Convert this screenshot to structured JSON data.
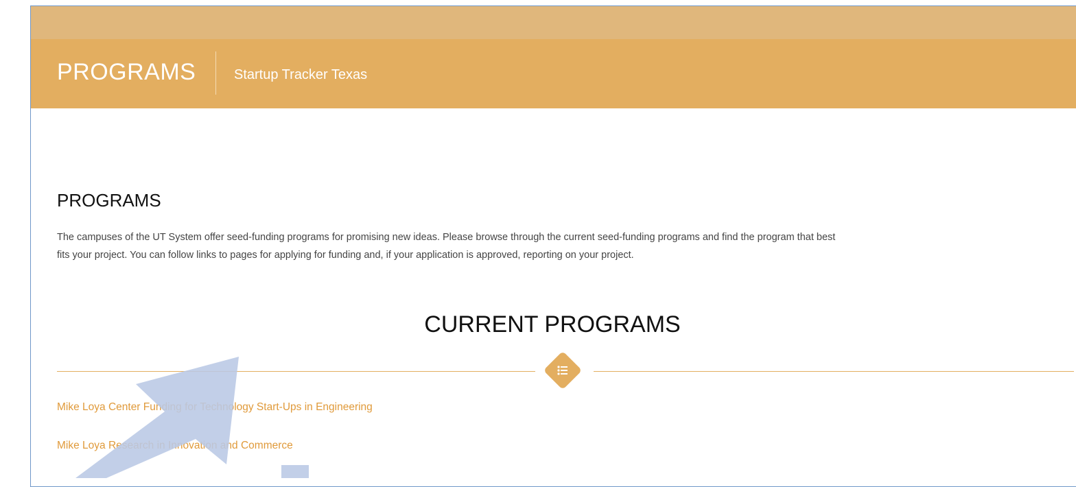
{
  "header": {
    "brand": "PROGRAMS",
    "site_name": "Startup Tracker Texas"
  },
  "main": {
    "heading": "PROGRAMS",
    "intro_line_1": "The campuses of the UT System offer seed-funding programs for promising new ideas. Please browse through the current seed-funding programs and find the program that best",
    "intro_line_2": "fits your project. You can follow links to pages for applying for funding and, if your application is approved, reporting on your project.",
    "current_title": "CURRENT PROGRAMS",
    "divider_icon": "list-icon",
    "programs": [
      {
        "label": "Mike Loya Center Funding for Technology Start-Ups in Engineering"
      },
      {
        "label": "Mike Loya Research in Innovation and Commerce"
      }
    ]
  },
  "colors": {
    "header_bg": "#e3ae60",
    "top_strip": "#e0b77c",
    "link": "#e09a3a",
    "annotation_arrow": "#b9c8e5"
  }
}
